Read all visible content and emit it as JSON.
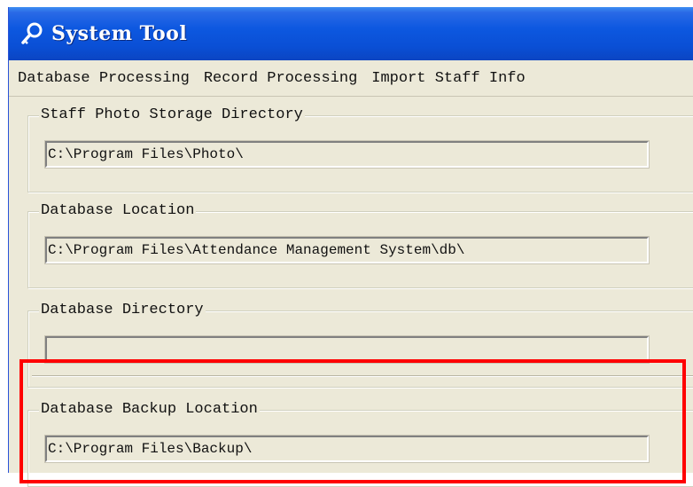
{
  "window": {
    "title": "System Tool",
    "icon": "key-icon"
  },
  "menu": {
    "items": [
      {
        "label": "Database Processing"
      },
      {
        "label": "Record Processing"
      },
      {
        "label": "Import Staff Info"
      }
    ]
  },
  "groups": {
    "photo": {
      "label": "Staff Photo Storage Directory",
      "value": "C:\\Program Files\\Photo\\"
    },
    "db_location": {
      "label": "Database Location",
      "value": "C:\\Program Files\\Attendance Management System\\db\\"
    },
    "db_directory": {
      "label": "Database Directory",
      "value": ""
    },
    "backup": {
      "label": "Database Backup Location",
      "value": "C:\\Program Files\\Backup\\"
    }
  },
  "colors": {
    "titlebar": "#0d58e0",
    "window_bg": "#ece9d8",
    "highlight": "#ff0000"
  }
}
